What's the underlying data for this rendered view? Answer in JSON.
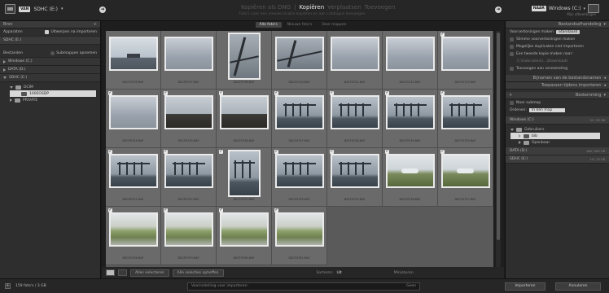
{
  "topbar": {
    "source_badge": "VAN",
    "source_name": "SDHC (E:)",
    "mode_tabs": [
      "Kopiëren als DNG",
      "Kopiëren",
      "Verplaatsen",
      "Toevoegen"
    ],
    "mode_active_index": 1,
    "mode_subtitle": "Foto's naar een nieuwe locatie kopiëren en aan catalogus toevoegen",
    "dest_badge": "NAAR",
    "dest_name": "Windows (C:)",
    "dest_path": "Mijn afbeeldingen"
  },
  "left": {
    "header": "Bron",
    "eject_label": "Uitwerpen na importeren",
    "devices_label": "Apparaten",
    "device_sub": "SDHC (E:)",
    "files_label": "Bestanden",
    "subfolders_label": "Submappen opnemen",
    "volumes": [
      {
        "name": "Windows (C:)",
        "expanded": false
      },
      {
        "name": "DATA (D:)",
        "expanded": false
      },
      {
        "name": "SDHC (E:)",
        "expanded": true
      }
    ],
    "tree": [
      {
        "label": "DCIM",
        "indent": 1,
        "selected": false
      },
      {
        "label": "100EOSDP",
        "indent": 2,
        "selected": true
      },
      {
        "label": "PRIVATE",
        "indent": 1,
        "selected": false
      }
    ]
  },
  "center": {
    "filters": [
      "Alle foto's",
      "Nieuwe foto's",
      "Doel mappen"
    ],
    "active_filter": 0,
    "photos": [
      {
        "file": "DSCF0735.RAF",
        "checked": false,
        "tall": false,
        "scene": "harbor"
      },
      {
        "file": "DSCF0737.RAF",
        "checked": false,
        "tall": false,
        "scene": "sky"
      },
      {
        "file": "DSCF0738.RAF",
        "checked": false,
        "tall": true,
        "scene": "bridge"
      },
      {
        "file": "DSCF0740.RAF",
        "checked": false,
        "tall": false,
        "scene": "bridge"
      },
      {
        "file": "DSCF0741.RAF",
        "checked": false,
        "tall": false,
        "scene": "sky"
      },
      {
        "file": "DSCF0742.RAF",
        "checked": false,
        "tall": false,
        "scene": "sky"
      },
      {
        "file": "DSCF0743.RAF",
        "checked": true,
        "tall": false,
        "scene": "sky"
      },
      {
        "file": "DSCF0744.RAF",
        "checked": true,
        "tall": false,
        "scene": "sky"
      },
      {
        "file": "DSCF0745.RAF",
        "checked": true,
        "tall": false,
        "scene": "pile"
      },
      {
        "file": "DSCF0746.RAF",
        "checked": true,
        "tall": false,
        "scene": "pile"
      },
      {
        "file": "DSCF0747.RAF",
        "checked": true,
        "tall": false,
        "scene": "crane"
      },
      {
        "file": "DSCF0748.RAF",
        "checked": true,
        "tall": false,
        "scene": "crane"
      },
      {
        "file": "DSCF0749.RAF",
        "checked": true,
        "tall": false,
        "scene": "crane"
      },
      {
        "file": "DSCF0750.RAF",
        "checked": true,
        "tall": false,
        "scene": "crane"
      },
      {
        "file": "DSCF0751.RAF",
        "checked": true,
        "tall": false,
        "scene": "crane"
      },
      {
        "file": "DSCF0752.RAF",
        "checked": true,
        "tall": false,
        "scene": "crane"
      },
      {
        "file": "DSCF0753.RAF",
        "checked": true,
        "tall": true,
        "scene": "crane"
      },
      {
        "file": "DSCF0754.RAF",
        "checked": true,
        "tall": false,
        "scene": "crane"
      },
      {
        "file": "DSCF0755.RAF",
        "checked": true,
        "tall": false,
        "scene": "crane"
      },
      {
        "file": "DSCF0756.RAF",
        "checked": true,
        "tall": false,
        "scene": "car"
      },
      {
        "file": "DSCF0757.RAF",
        "checked": true,
        "tall": false,
        "scene": "car"
      },
      {
        "file": "DSCF0758.RAF",
        "checked": true,
        "tall": false,
        "scene": "blur"
      },
      {
        "file": "DSCF0759.RAF",
        "checked": true,
        "tall": false,
        "scene": "blur"
      },
      {
        "file": "DSCF0760.RAF",
        "checked": true,
        "tall": false,
        "scene": "blur"
      },
      {
        "file": "DSCF0761.RAF",
        "checked": true,
        "tall": false,
        "scene": "blur"
      }
    ],
    "check_all_label": "Alles selecteren",
    "uncheck_all_label": "Alle selecties opheffen",
    "sort_label": "Sorteren:",
    "sort_value": "Uit",
    "thumb_label": "Miniaturen"
  },
  "right": {
    "file_handling_header": "Bestandsafhandeling",
    "build_previews_label": "Voorvertoningen maken",
    "build_previews_value": "Standaard",
    "smart_previews_label": "Slimme voorvertoningen maken",
    "no_duplicates_label": "Mogelijke duplicaten niet importeren",
    "second_copy_label": "Een tweede kopie maken naar:",
    "second_copy_path": "C:\\Gebruikers\\...\\Downloads",
    "add_collection_label": "Toevoegen aan verzameling",
    "rename_header": "Bijnamen van de bestandsnamen",
    "apply_header": "Toepassen tijdens importeren",
    "destination_header": "Bestemming",
    "into_subfolder_label": "Naar submap",
    "organize_label": "Ordenen:",
    "organize_value": "In één map",
    "dest_volumes": [
      {
        "name": "Windows (C:)",
        "meter": "31 / 59 GB"
      },
      {
        "name": "DATA (D:)",
        "meter": "186 / 465 GB"
      },
      {
        "name": "SDHC (E:)",
        "meter": "10 / 15 GB"
      }
    ],
    "dest_tree": [
      {
        "label": "Gebruikers",
        "expanded": true
      },
      {
        "label": "bib",
        "expanded": false
      },
      {
        "label": "Openbaar",
        "expanded": false
      }
    ]
  },
  "status": {
    "count": "159 foto's / 3 GB",
    "preset_label": "Voorinstelling voor importeren:",
    "preset_value": "Geen",
    "import_label": "Importeren",
    "cancel_label": "Annuleren"
  }
}
